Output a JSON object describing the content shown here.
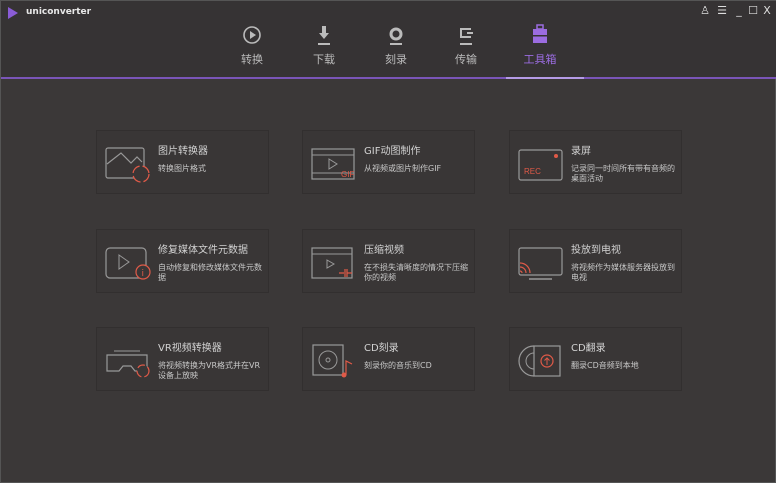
{
  "app": {
    "title": "uniconverter"
  },
  "window": {
    "user_icon": "user-icon",
    "menu_icon": "menu-icon",
    "min": "_",
    "max": "☐",
    "close": "X"
  },
  "tabs": [
    {
      "label": "转换",
      "icon": "convert-icon"
    },
    {
      "label": "下载",
      "icon": "download-icon"
    },
    {
      "label": "刻录",
      "icon": "burn-icon"
    },
    {
      "label": "传输",
      "icon": "transfer-icon"
    },
    {
      "label": "工具箱",
      "icon": "toolbox-icon",
      "active": true
    }
  ],
  "accent": "#9b6ce0",
  "icon_red": "#e05a48",
  "tools": [
    {
      "title": "图片转换器",
      "desc": "转换图片格式"
    },
    {
      "title": "GIF动图制作",
      "desc": "从视频或图片制作GIF",
      "badge": "GIF"
    },
    {
      "title": "录屏",
      "desc": "记录同一时间所有带有音频的桌面活动",
      "badge": "REC"
    },
    {
      "title": "修复媒体文件元数据",
      "desc": "自动修复和修改媒体文件元数据"
    },
    {
      "title": "压缩视频",
      "desc": "在不损失清晰度的情况下压缩你的视频"
    },
    {
      "title": "投放到电视",
      "desc": "将视频作为媒体服务器投放到电视"
    },
    {
      "title": "VR视频转换器",
      "desc": "将视频转换为VR格式并在VR设备上放映"
    },
    {
      "title": "CD刻录",
      "desc": "刻录你的音乐到CD"
    },
    {
      "title": "CD翻录",
      "desc": "翻录CD音频到本地"
    }
  ]
}
